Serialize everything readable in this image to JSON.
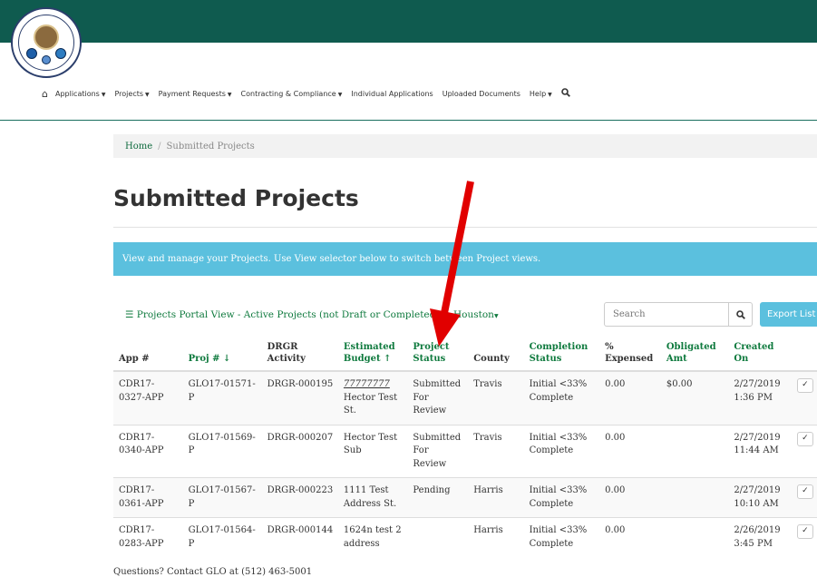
{
  "nav": {
    "home_icon": "home-icon",
    "items": [
      {
        "label": "Applications",
        "has_caret": true
      },
      {
        "label": "Projects",
        "has_caret": true
      },
      {
        "label": "Payment Requests",
        "has_caret": true
      },
      {
        "label": "Contracting & Compliance",
        "has_caret": true
      },
      {
        "label": "Individual Applications",
        "has_caret": false
      },
      {
        "label": "Uploaded Documents",
        "has_caret": false
      },
      {
        "label": "Help",
        "has_caret": true
      }
    ],
    "search_icon": "search-icon"
  },
  "breadcrumb": {
    "home": "Home",
    "separator": "/",
    "current": "Submitted Projects"
  },
  "page_title": "Submitted Projects",
  "info_message": "View and manage your Projects. Use View selector below to switch between Project views.",
  "controls": {
    "view_selector": "Projects Portal View - Active Projects (not Draft or Completed)",
    "city_selector": "Houston",
    "search_placeholder": "Search",
    "export_label": "Export List"
  },
  "table": {
    "headers": [
      {
        "label": "App #",
        "sortable": false
      },
      {
        "label": "Proj # ↓",
        "sortable": true
      },
      {
        "label": "DRGR Activity",
        "sortable": false
      },
      {
        "label": "Estimated Budget ↑",
        "sortable": true
      },
      {
        "label": "Project Status",
        "sortable": true
      },
      {
        "label": "County",
        "sortable": false
      },
      {
        "label": "Completion Status",
        "sortable": true
      },
      {
        "label": "% Expensed",
        "sortable": false
      },
      {
        "label": "Obligated Amt",
        "sortable": true
      },
      {
        "label": "Created On",
        "sortable": true
      }
    ],
    "rows": [
      {
        "app": "CDR17-0327-APP",
        "proj": "GLO17-01571-P",
        "drgr": "DRGR-000195",
        "budget_num": "77777777",
        "budget_desc": "Hector Test St.",
        "status": "Submitted For Review",
        "county": "Travis",
        "completion": "Initial <33% Complete",
        "expensed": "0.00",
        "obligated": "$0.00",
        "created": "2/27/2019 1:36 PM"
      },
      {
        "app": "CDR17-0340-APP",
        "proj": "GLO17-01569-P",
        "drgr": "DRGR-000207",
        "budget_num": "",
        "budget_desc": "Hector Test Sub",
        "status": "Submitted For Review",
        "county": "Travis",
        "completion": "Initial <33% Complete",
        "expensed": "0.00",
        "obligated": "",
        "created": "2/27/2019 11:44 AM"
      },
      {
        "app": "CDR17-0361-APP",
        "proj": "GLO17-01567-P",
        "drgr": "DRGR-000223",
        "budget_num": "",
        "budget_desc": "1111 Test Address St.",
        "status": "Pending",
        "county": "Harris",
        "completion": "Initial <33% Complete",
        "expensed": "0.00",
        "obligated": "",
        "created": "2/27/2019 10:10 AM"
      },
      {
        "app": "CDR17-0283-APP",
        "proj": "GLO17-01564-P",
        "drgr": "DRGR-000144",
        "budget_num": "",
        "budget_desc": "1624n test 2 address",
        "status": "",
        "county": "Harris",
        "completion": "Initial <33% Complete",
        "expensed": "0.00",
        "obligated": "",
        "created": "2/26/2019 3:45 PM"
      }
    ]
  },
  "footer": "Questions? Contact GLO at (512) 463-5001",
  "colors": {
    "topbar": "#0f5b4f",
    "link_green": "#0f7a3e",
    "info_blue": "#5bc0de",
    "annotation_red": "#e10000"
  }
}
